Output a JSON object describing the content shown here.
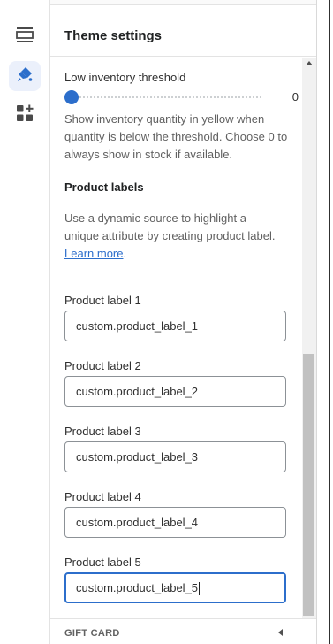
{
  "rail": {
    "items": [
      {
        "icon": "sections-icon",
        "active": false
      },
      {
        "icon": "paint-brush-icon",
        "active": true
      },
      {
        "icon": "apps-add-icon",
        "active": false
      }
    ]
  },
  "panel": {
    "title": "Theme settings"
  },
  "inventory": {
    "label": "Low inventory threshold",
    "value": "0",
    "slider_fraction": 0,
    "help": "Show inventory quantity in yellow when quantity is below the threshold. Choose 0 to always show in stock if available."
  },
  "product_labels": {
    "heading": "Product labels",
    "help_text": "Use a dynamic source to highlight a unique attribute by creating product label.",
    "link": "Learn more",
    "link_suffix": ".",
    "fields": [
      {
        "label": "Product label 1",
        "value": "custom.product_label_1"
      },
      {
        "label": "Product label 2",
        "value": "custom.product_label_2"
      },
      {
        "label": "Product label 3",
        "value": "custom.product_label_3"
      },
      {
        "label": "Product label 4",
        "value": "custom.product_label_4"
      },
      {
        "label": "Product label 5",
        "value": "custom.product_label_5"
      }
    ]
  },
  "footer": {
    "label": "GIFT CARD"
  },
  "colors": {
    "accent": "#2c6ecb",
    "active_bg": "#ebf0fb"
  }
}
